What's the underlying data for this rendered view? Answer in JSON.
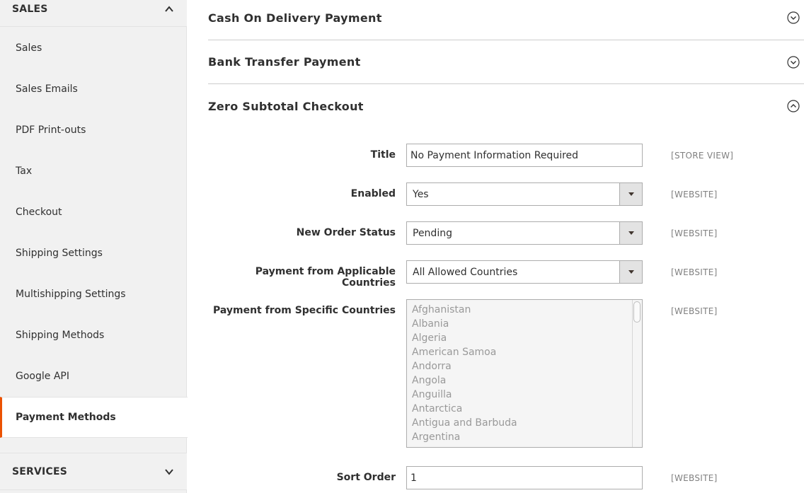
{
  "sidebar": {
    "sales_header": "SALES",
    "items": [
      {
        "label": "Sales"
      },
      {
        "label": "Sales Emails"
      },
      {
        "label": "PDF Print-outs"
      },
      {
        "label": "Tax"
      },
      {
        "label": "Checkout"
      },
      {
        "label": "Shipping Settings"
      },
      {
        "label": "Multishipping Settings"
      },
      {
        "label": "Shipping Methods"
      },
      {
        "label": "Google API"
      },
      {
        "label": "Payment Methods"
      }
    ],
    "active_item": "Payment Methods",
    "services_header": "SERVICES",
    "colors": {
      "active_accent": "#eb5202"
    }
  },
  "groups": {
    "cod": {
      "title": "Cash On Delivery Payment",
      "state": "collapsed"
    },
    "bank": {
      "title": "Bank Transfer Payment",
      "state": "collapsed"
    },
    "zero": {
      "title": "Zero Subtotal Checkout",
      "state": "expanded"
    }
  },
  "form": {
    "title": {
      "label": "Title",
      "value": "No Payment Information Required",
      "scope": "[STORE VIEW]"
    },
    "enabled": {
      "label": "Enabled",
      "value": "Yes",
      "scope": "[WEBSITE]"
    },
    "new_order_status": {
      "label": "New Order Status",
      "value": "Pending",
      "scope": "[WEBSITE]"
    },
    "applicable_countries": {
      "label": "Payment from Applicable Countries",
      "value": "All Allowed Countries",
      "scope": "[WEBSITE]"
    },
    "specific_countries": {
      "label": "Payment from Specific Countries",
      "scope": "[WEBSITE]",
      "options": [
        "Afghanistan",
        "Albania",
        "Algeria",
        "American Samoa",
        "Andorra",
        "Angola",
        "Anguilla",
        "Antarctica",
        "Antigua and Barbuda",
        "Argentina"
      ]
    },
    "sort_order": {
      "label": "Sort Order",
      "value": "1",
      "scope": "[WEBSITE]"
    }
  }
}
